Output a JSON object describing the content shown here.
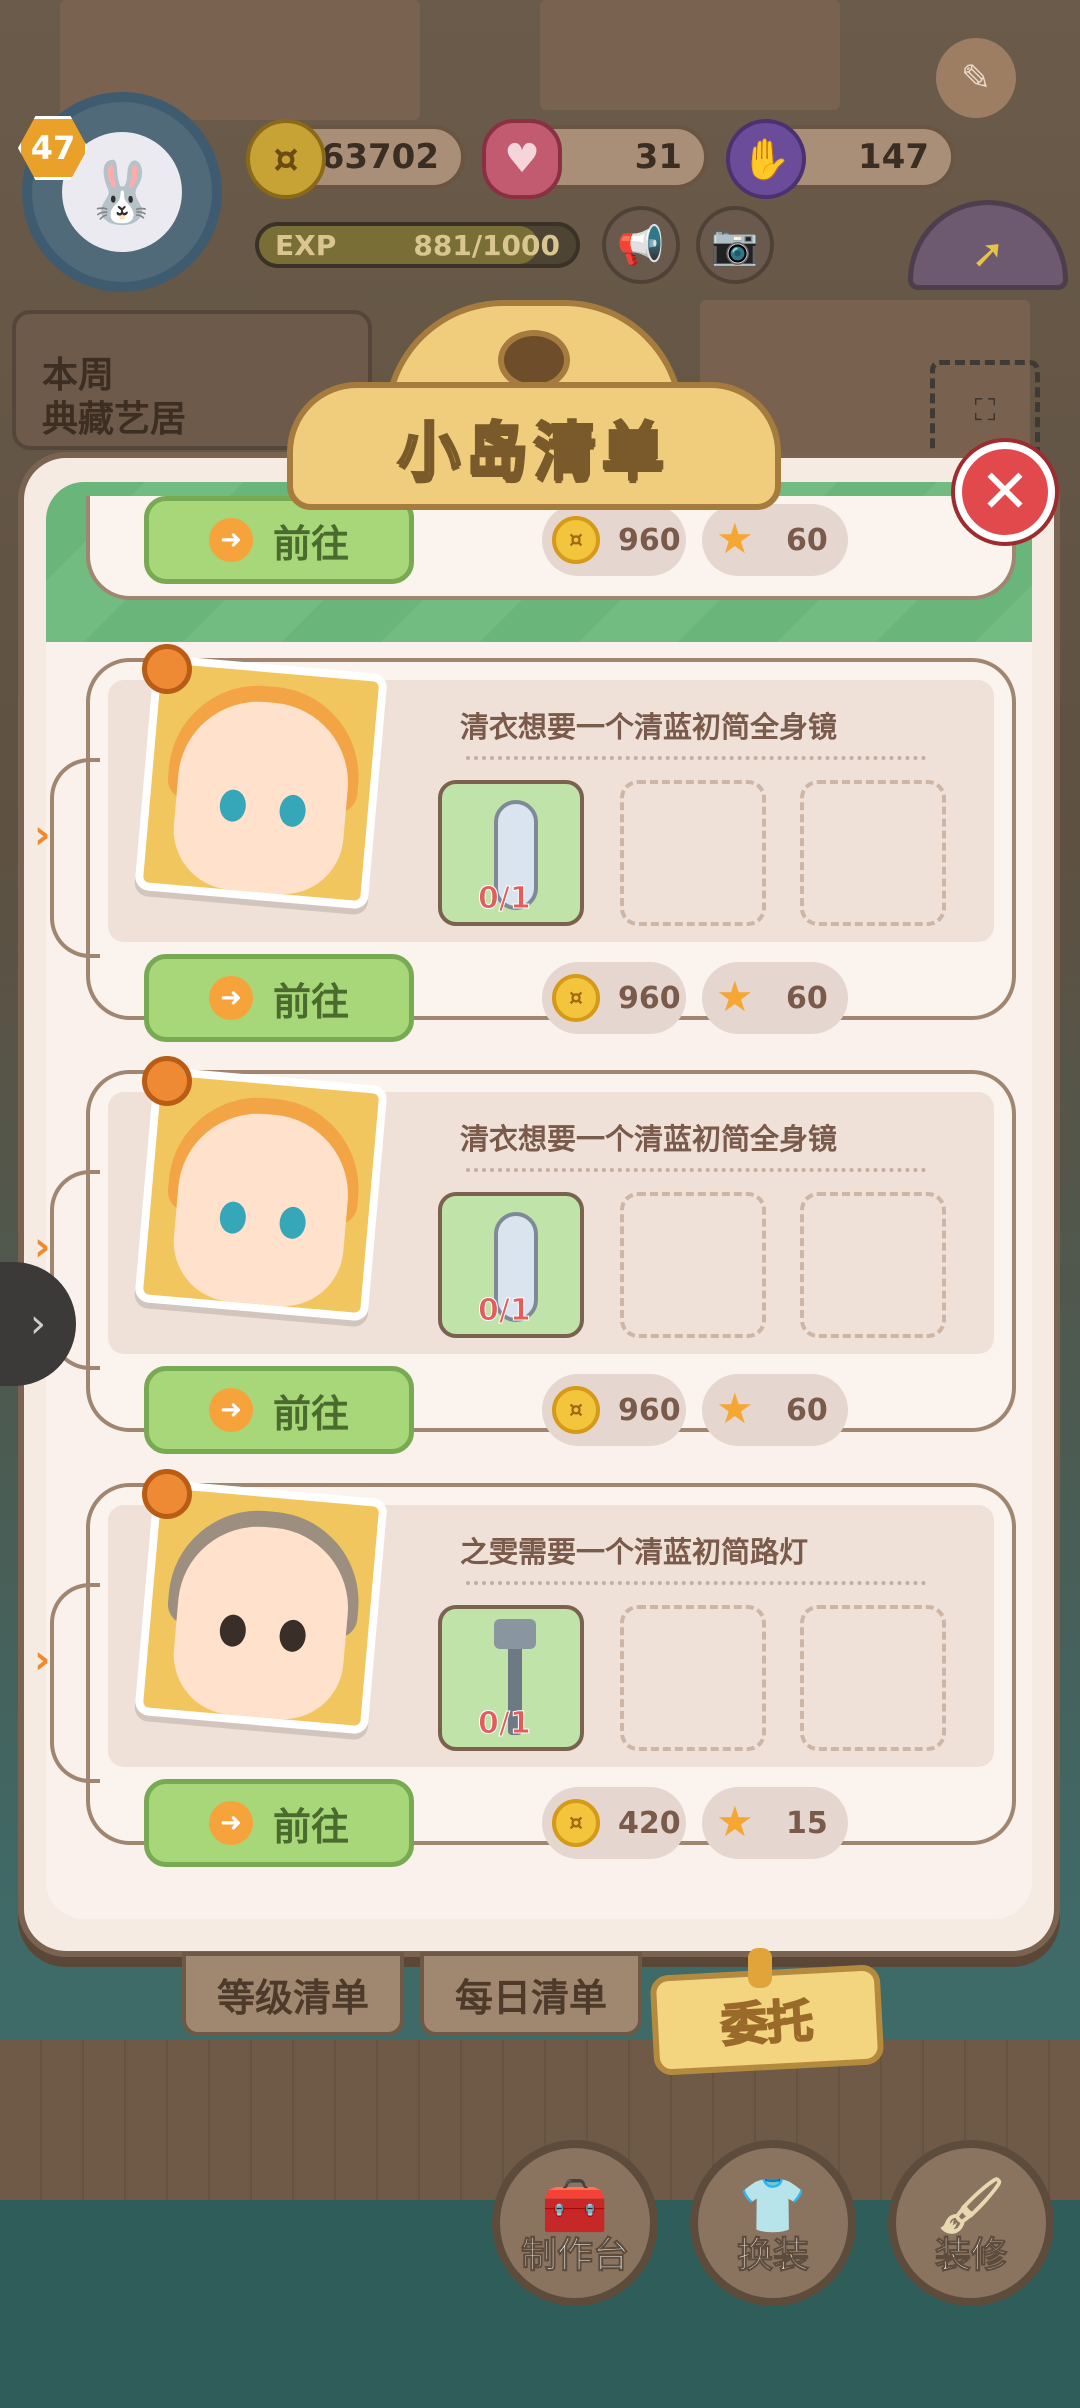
{
  "hud": {
    "level": "47",
    "coins": "63702",
    "hearts": "31",
    "stamina": "147",
    "exp_label": "EXP",
    "exp_value": "881/1000",
    "exp_fraction": 0.881,
    "weekly_line1": "本周",
    "weekly_line2": "典藏艺居"
  },
  "modal": {
    "title": "小岛清单",
    "go_label": "前往",
    "top_partial": {
      "coin_reward": "960",
      "star_reward": "60"
    },
    "orders": [
      {
        "request": "清衣想要一个清蓝初简全身镜",
        "progress": "0/1",
        "coin_reward": "960",
        "star_reward": "60",
        "item": "mirror"
      },
      {
        "request": "清衣想要一个清蓝初简全身镜",
        "progress": "0/1",
        "coin_reward": "960",
        "star_reward": "60",
        "item": "mirror"
      },
      {
        "request": "之雯需要一个清蓝初简路灯",
        "progress": "0/1",
        "coin_reward": "420",
        "star_reward": "15",
        "item": "lamp"
      }
    ]
  },
  "tabs": {
    "level_list": "等级清单",
    "daily_list": "每日清单",
    "entrust": "委托"
  },
  "dock": {
    "workbench": "制作台",
    "outfit": "换装",
    "decorate": "装修"
  },
  "icons": {
    "coin": "rabbit-coin-icon",
    "star": "star-icon",
    "close": "close-icon",
    "arrow": "arrow-right-icon"
  }
}
